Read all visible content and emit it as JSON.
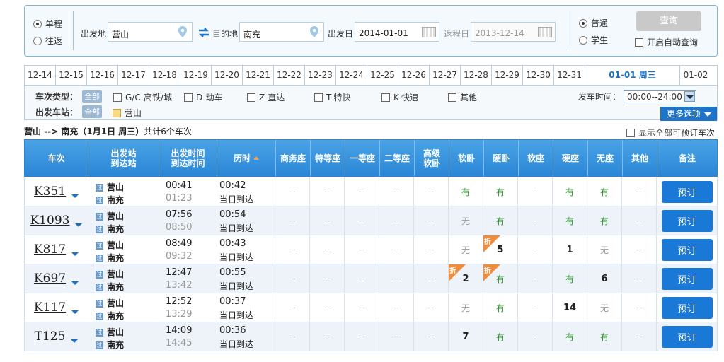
{
  "search": {
    "trip_one_way": "单程",
    "trip_round": "往返",
    "from_label": "出发地",
    "from_value": "营山",
    "to_label": "目的地",
    "to_value": "南充",
    "depart_label": "出发日",
    "depart_value": "2014-01-01",
    "return_label": "返程日",
    "return_value": "2013-12-14",
    "type_normal": "普通",
    "type_student": "学生",
    "query_button": "查询",
    "auto_query": "开启自动查询"
  },
  "date_tabs": [
    "12-14",
    "12-15",
    "12-16",
    "12-17",
    "12-18",
    "12-19",
    "12-20",
    "12-21",
    "12-22",
    "12-23",
    "12-24",
    "12-25",
    "12-26",
    "12-27",
    "12-28",
    "12-29",
    "12-30",
    "12-31",
    "01-01 周三",
    "01-02"
  ],
  "filter": {
    "train_type_label": "车次类型：",
    "all": "全部",
    "types": [
      "G/C-高铁/城",
      "D-动车",
      "Z-直达",
      "T-特快",
      "K-快速",
      "其他"
    ],
    "depart_time_label": "发车时间：",
    "depart_time_value": "00:00--24:00",
    "station_label": "出发车站：",
    "station_all": "全部",
    "station_option": "营山",
    "more_options": "更多选项"
  },
  "summary": {
    "route": "营山 --> 南充（1月1日  周三）",
    "count": "共计6个车次",
    "show_all": "显示全部可预订车次"
  },
  "table": {
    "headers": {
      "train": "车次",
      "station1": "出发站",
      "station2": "到达站",
      "time1": "出发时间",
      "time2": "到达时间",
      "duration": "历时",
      "business": "商务座",
      "special": "特等座",
      "first": "一等座",
      "second": "二等座",
      "premium1": "高级",
      "premium2": "软卧",
      "soft_sleeper": "软卧",
      "hard_sleeper": "硬卧",
      "soft_seat": "软座",
      "hard_seat": "硬座",
      "no_seat": "无座",
      "other": "其他",
      "remark": "备注"
    },
    "pass_icon": "过",
    "book_label": "预订",
    "rows": [
      {
        "train": "K351",
        "from": "营山",
        "to": "南充",
        "dep": "00:41",
        "arr": "01:23",
        "dur": "00:42",
        "arrive": "当日到达",
        "seats": [
          "--",
          "--",
          "--",
          "--",
          "--",
          "有",
          "有",
          "--",
          "有",
          "有",
          "--"
        ],
        "disc": [
          false,
          false,
          false,
          false,
          false,
          false,
          false,
          false,
          false,
          false,
          false
        ]
      },
      {
        "train": "K1093",
        "from": "营山",
        "to": "南充",
        "dep": "07:56",
        "arr": "08:50",
        "dur": "00:54",
        "arrive": "当日到达",
        "seats": [
          "--",
          "--",
          "--",
          "--",
          "--",
          "无",
          "有",
          "--",
          "有",
          "有",
          "--"
        ],
        "disc": [
          false,
          false,
          false,
          false,
          false,
          false,
          false,
          false,
          false,
          false,
          false
        ]
      },
      {
        "train": "K817",
        "from": "营山",
        "to": "南充",
        "dep": "08:49",
        "arr": "09:32",
        "dur": "00:43",
        "arrive": "当日到达",
        "seats": [
          "--",
          "--",
          "--",
          "--",
          "--",
          "无",
          "5",
          "--",
          "1",
          "无",
          "--"
        ],
        "disc": [
          false,
          false,
          false,
          false,
          false,
          false,
          true,
          false,
          false,
          false,
          false
        ]
      },
      {
        "train": "K697",
        "from": "营山",
        "to": "南充",
        "dep": "12:47",
        "arr": "13:42",
        "dur": "00:55",
        "arrive": "当日到达",
        "seats": [
          "--",
          "--",
          "--",
          "--",
          "--",
          "2",
          "有",
          "--",
          "有",
          "6",
          "--"
        ],
        "disc": [
          false,
          false,
          false,
          false,
          false,
          true,
          true,
          false,
          false,
          false,
          false
        ]
      },
      {
        "train": "K117",
        "from": "营山",
        "to": "南充",
        "dep": "12:52",
        "arr": "13:29",
        "dur": "00:37",
        "arrive": "当日到达",
        "seats": [
          "--",
          "--",
          "--",
          "--",
          "--",
          "无",
          "有",
          "--",
          "14",
          "无",
          "--"
        ],
        "disc": [
          false,
          false,
          false,
          false,
          false,
          false,
          false,
          false,
          false,
          false,
          false
        ]
      },
      {
        "train": "T125",
        "from": "营山",
        "to": "南充",
        "dep": "14:09",
        "arr": "14:45",
        "dur": "00:36",
        "arrive": "当日到达",
        "seats": [
          "--",
          "--",
          "--",
          "--",
          "--",
          "7",
          "有",
          "--",
          "有",
          "有",
          "--"
        ],
        "disc": [
          false,
          false,
          false,
          false,
          false,
          false,
          false,
          false,
          false,
          false,
          false
        ]
      }
    ],
    "discount_mark": "折"
  },
  "colors": {
    "accent": "#2b86d6",
    "have": "#2e8a2e",
    "discount": "#f08c3c"
  }
}
